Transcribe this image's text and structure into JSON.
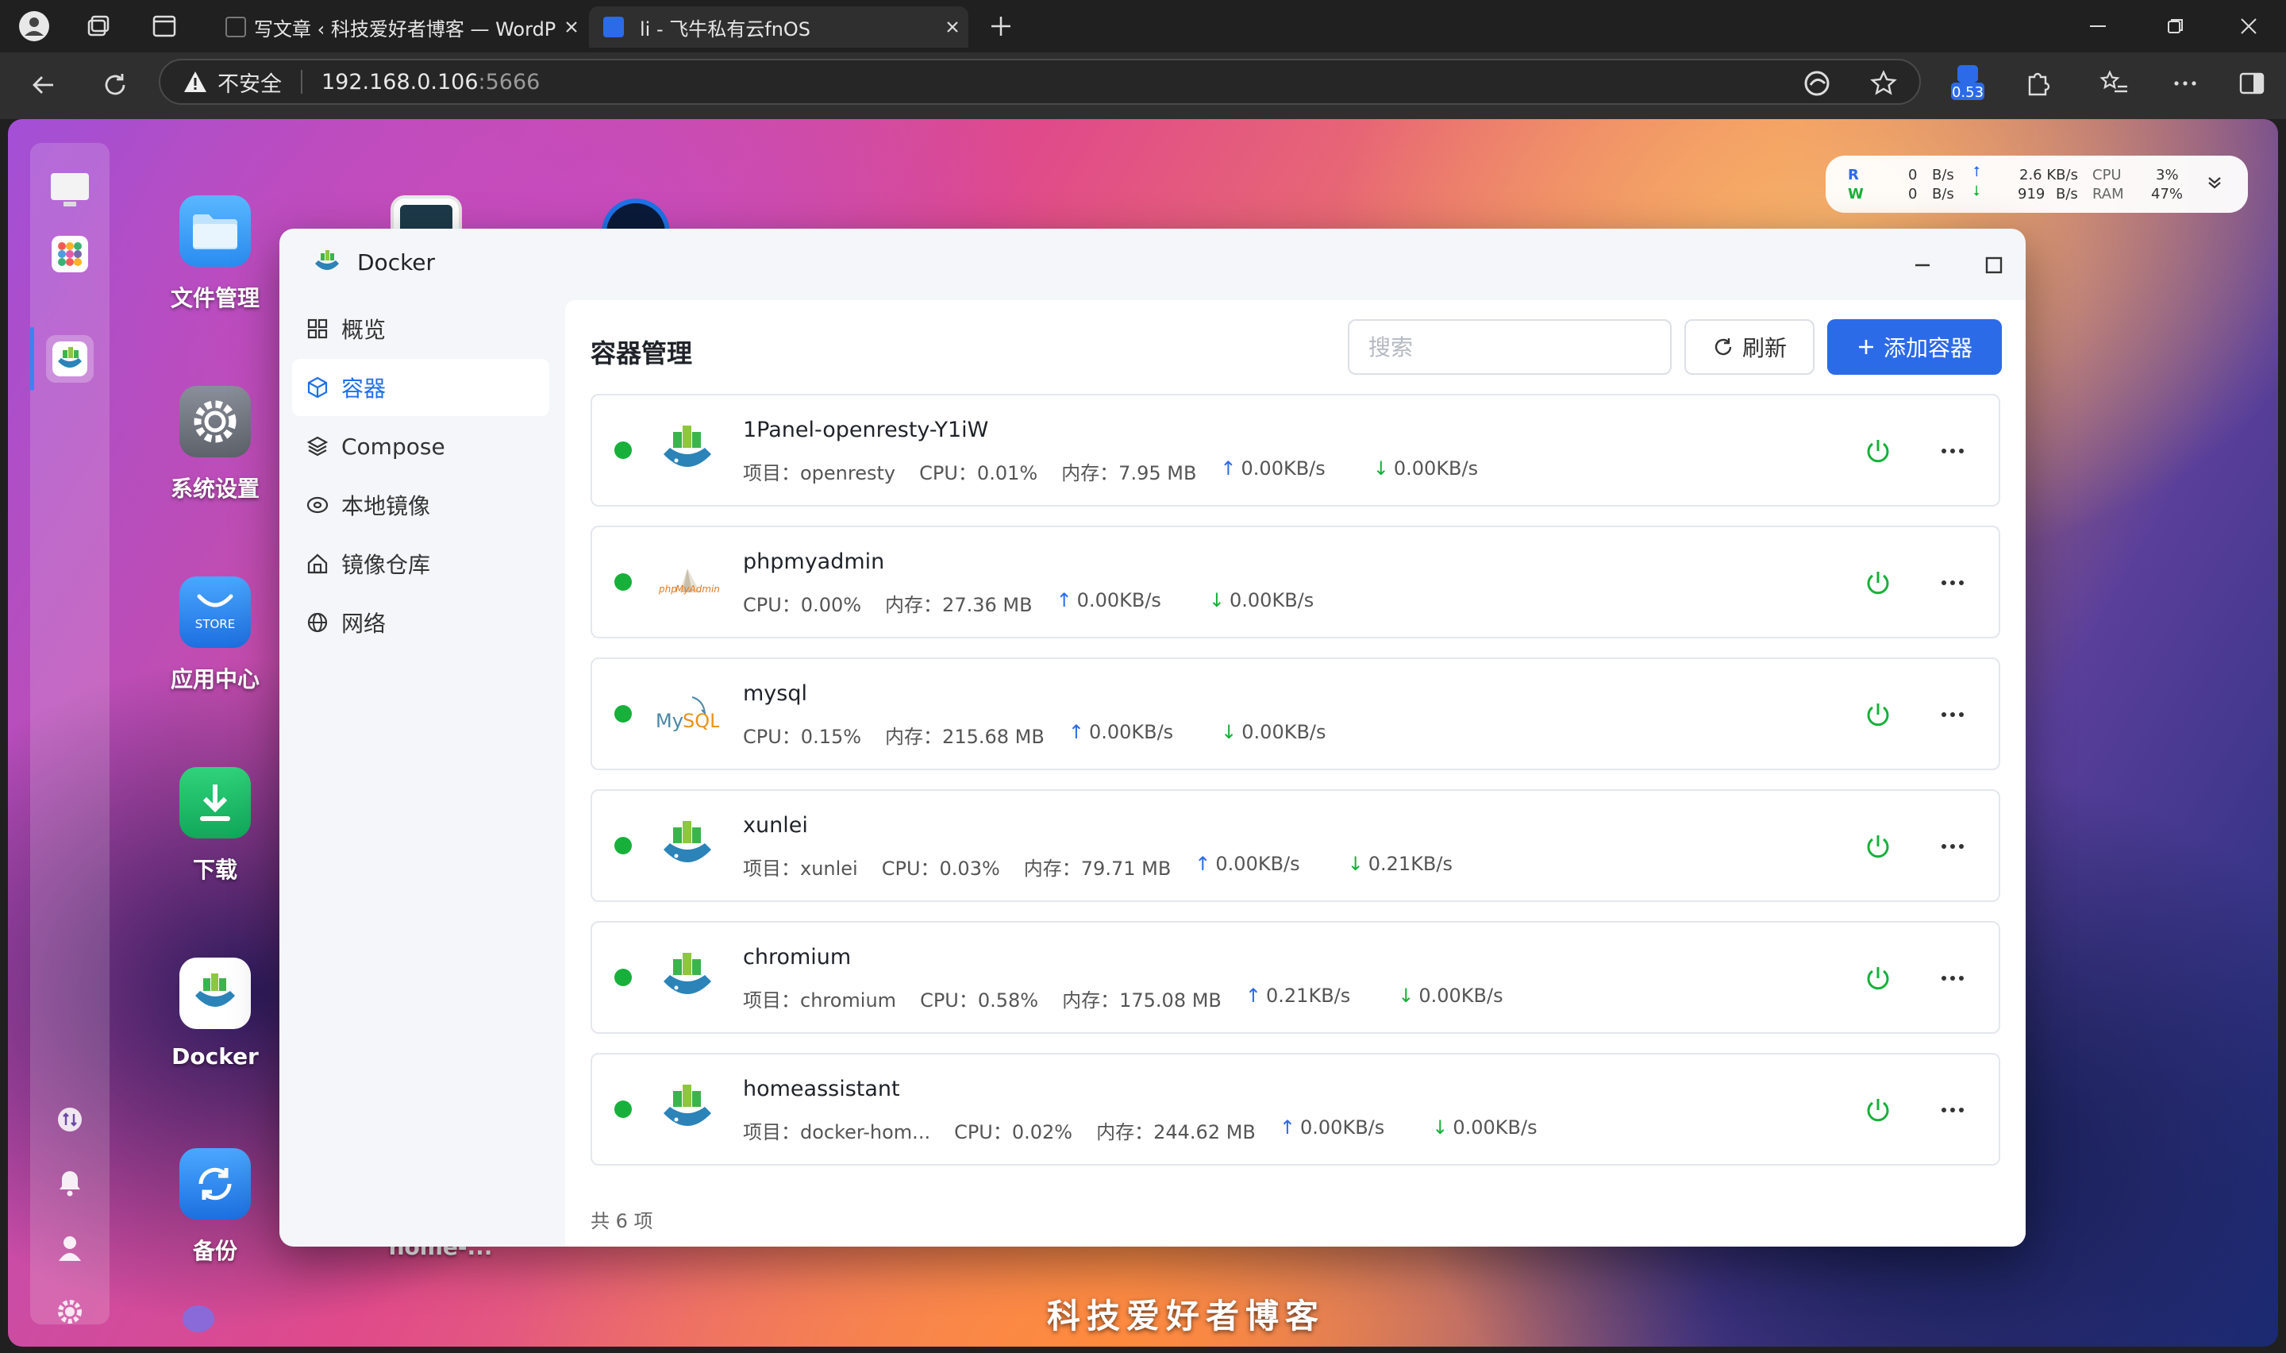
{
  "browser": {
    "tabs": [
      {
        "title": "写文章 ‹ 科技爱好者博客 — WordPress"
      },
      {
        "title": "li - 飞牛私有云fnOS"
      }
    ],
    "security_label": "不安全",
    "url_host": "192.168.0.106",
    "url_port": ":5666",
    "extension_badge": "0.53"
  },
  "desktop": {
    "apps": [
      {
        "label": "文件管理"
      },
      {
        "label": "系统设置"
      },
      {
        "label": "应用中心",
        "store_text": "STORE"
      },
      {
        "label": "下载"
      },
      {
        "label": "Docker"
      },
      {
        "label": "备份"
      },
      {
        "label": "home-..."
      }
    ],
    "watermark": "科技爱好者博客"
  },
  "sysmon": {
    "r_label": "R",
    "w_label": "W",
    "r_value": "0",
    "w_value": "0",
    "r_unit": "B/s",
    "w_unit": "B/s",
    "up_value": "2.6 KB/s",
    "down_value": "919",
    "down_unit": "B/s",
    "cpu_label": "CPU",
    "ram_label": "RAM",
    "cpu_value": "3%",
    "ram_value": "47%"
  },
  "window": {
    "title": "Docker",
    "nav": [
      {
        "label": "概览"
      },
      {
        "label": "容器"
      },
      {
        "label": "Compose"
      },
      {
        "label": "本地镜像"
      },
      {
        "label": "镜像仓库"
      },
      {
        "label": "网络"
      }
    ],
    "content_title": "容器管理",
    "search_placeholder": "搜索",
    "refresh_label": "刷新",
    "add_label": "添加容器",
    "footer": "共 6 项",
    "containers": [
      {
        "name": "1Panel-openresty-Y1iW",
        "project": "项目：openresty",
        "cpu": "CPU：0.01%",
        "mem": "内存：7.95 MB",
        "up": "0.00KB/s",
        "down": "0.00KB/s"
      },
      {
        "name": "phpmyadmin",
        "project": "",
        "cpu": "CPU：0.00%",
        "mem": "内存：27.36 MB",
        "up": "0.00KB/s",
        "down": "0.00KB/s"
      },
      {
        "name": "mysql",
        "project": "",
        "cpu": "CPU：0.15%",
        "mem": "内存：215.68 MB",
        "up": "0.00KB/s",
        "down": "0.00KB/s"
      },
      {
        "name": "xunlei",
        "project": "项目：xunlei",
        "cpu": "CPU：0.03%",
        "mem": "内存：79.71 MB",
        "up": "0.00KB/s",
        "down": "0.21KB/s"
      },
      {
        "name": "chromium",
        "project": "项目：chromium",
        "cpu": "CPU：0.58%",
        "mem": "内存：175.08 MB",
        "up": "0.21KB/s",
        "down": "0.00KB/s"
      },
      {
        "name": "homeassistant",
        "project": "项目：docker-hom...",
        "cpu": "CPU：0.02%",
        "mem": "内存：244.62 MB",
        "up": "0.00KB/s",
        "down": "0.00KB/s"
      }
    ]
  },
  "colors": {
    "accent": "#2c6be8",
    "running": "#17b03a",
    "power": "#17b03a"
  }
}
